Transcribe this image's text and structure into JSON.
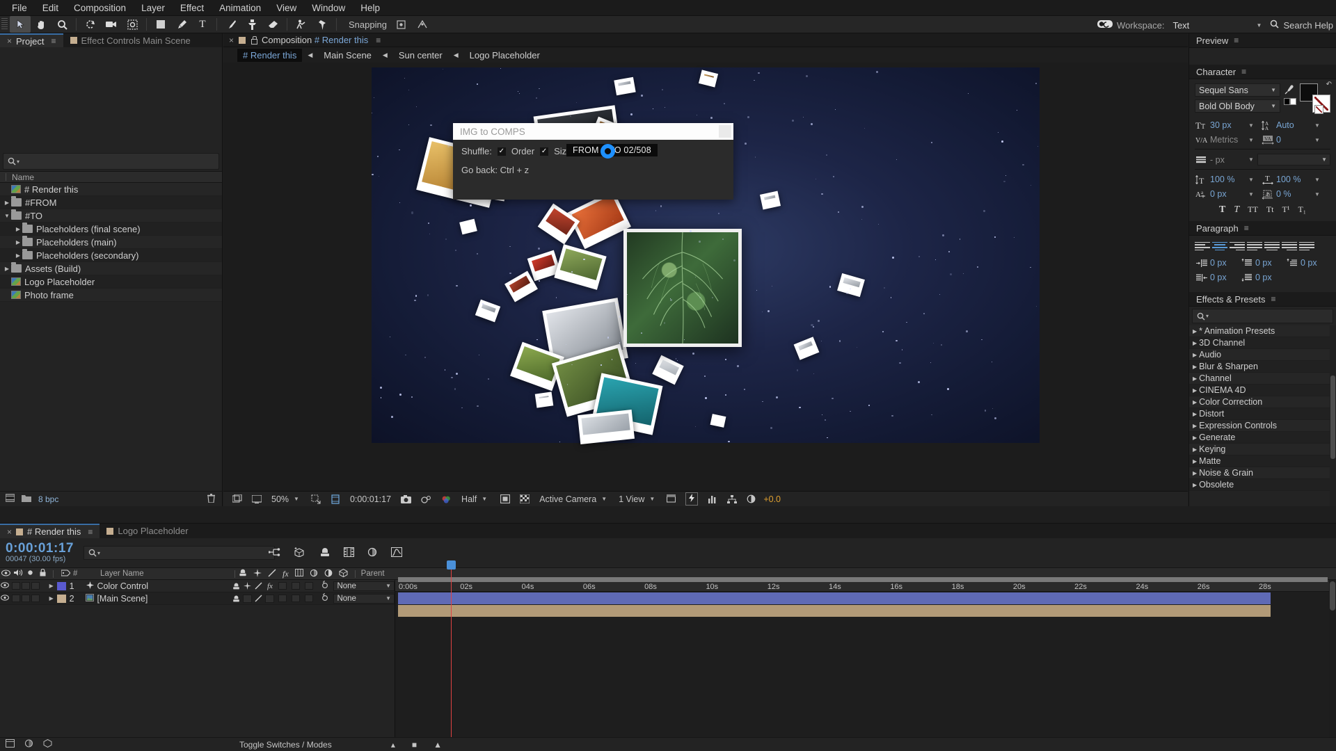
{
  "menu": [
    "File",
    "Edit",
    "Composition",
    "Layer",
    "Effect",
    "Animation",
    "View",
    "Window",
    "Help"
  ],
  "toolbar": {
    "snapping_label": "Snapping",
    "workspace_label": "Workspace:",
    "workspace_value": "Text",
    "search_help": "Search Help",
    "tools": [
      "select-tool",
      "hand-tool",
      "zoom-tool",
      "rotation-tool",
      "camera-tool",
      "pan-behind-tool",
      "shape-tool",
      "pen-tool",
      "type-tool",
      "brush-tool",
      "clone-stamp-tool",
      "eraser-tool",
      "roto-brush-tool",
      "puppet-pin-tool"
    ]
  },
  "project": {
    "tabs": [
      {
        "label": "Project",
        "active": true
      },
      {
        "label": "Effect Controls Main Scene",
        "active": false
      }
    ],
    "column_header": "Name",
    "items": [
      {
        "label": "# Render this",
        "type": "comp",
        "indent": 0,
        "tri": ""
      },
      {
        "label": "#FROM",
        "type": "folder",
        "indent": 0,
        "tri": "▶"
      },
      {
        "label": "#TO",
        "type": "folder",
        "indent": 0,
        "tri": "▼"
      },
      {
        "label": "Placeholders (final scene)",
        "type": "folder",
        "indent": 1,
        "tri": "▶"
      },
      {
        "label": "Placeholders (main)",
        "type": "folder",
        "indent": 1,
        "tri": "▶"
      },
      {
        "label": "Placeholders (secondary)",
        "type": "folder",
        "indent": 1,
        "tri": "▶"
      },
      {
        "label": "Assets (Build)",
        "type": "folder",
        "indent": 0,
        "tri": "▶"
      },
      {
        "label": "Logo Placeholder",
        "type": "comp",
        "indent": 0,
        "tri": ""
      },
      {
        "label": "Photo frame",
        "type": "comp",
        "indent": 0,
        "tri": ""
      }
    ],
    "bit_depth": "8 bpc"
  },
  "comp": {
    "tab_close": "×",
    "panel_label": "Composition",
    "comp_name": "# Render this",
    "breadcrumb": [
      {
        "label": "# Render this",
        "current": true
      },
      {
        "label": "Main Scene",
        "current": false
      },
      {
        "label": "Sun center",
        "current": false
      },
      {
        "label": "Logo Placeholder",
        "current": false
      }
    ],
    "footer": {
      "zoom": "50%",
      "time": "0:00:01:17",
      "resolution": "Half",
      "view_camera": "Active Camera",
      "views": "1 View",
      "exposure": "+0.0"
    }
  },
  "script_panel": {
    "title": "IMG to COMPS",
    "shuffle_label": "Shuffle:",
    "order_label": "Order",
    "size_label": "Size",
    "check_glyph": "✓",
    "progress_button": "FROM > TO  02/508",
    "progress_prefix": "FROM > TO",
    "progress_count": "02/508",
    "go_back": "Go back: Ctrl + z"
  },
  "right_dock": {
    "preview_title": "Preview",
    "character": {
      "title": "Character",
      "font_family": "Sequel Sans",
      "font_style": "Bold Obl Body",
      "font_size": "30 px",
      "leading": "Auto",
      "kerning": "Metrics",
      "tracking": "0",
      "stroke_width": "- px",
      "vertical_scale": "100 %",
      "horizontal_scale": "100 %",
      "baseline_shift": "0 px",
      "tsume": "0 %",
      "styles": [
        "T",
        "T",
        "TT",
        "Tt",
        "T¹",
        "T₁"
      ]
    },
    "paragraph": {
      "title": "Paragraph",
      "align_options": [
        "align-left",
        "align-center",
        "align-right",
        "justify-last-left",
        "justify-last-center",
        "justify-last-right",
        "justify-all"
      ],
      "active_align_index": 1,
      "indent_left": "0 px",
      "indent_right": "0 px",
      "indent_first": "0 px",
      "space_before": "0 px",
      "space_after": "0 px"
    },
    "effects_presets": {
      "title": "Effects & Presets",
      "items": [
        "* Animation Presets",
        "3D Channel",
        "Audio",
        "Blur & Sharpen",
        "Channel",
        "CINEMA 4D",
        "Color Correction",
        "Distort",
        "Expression Controls",
        "Generate",
        "Keying",
        "Matte",
        "Noise & Grain",
        "Obsolete"
      ]
    }
  },
  "timeline": {
    "tabs": [
      {
        "label": "# Render this",
        "active": true
      },
      {
        "label": "Logo Placeholder",
        "active": false
      }
    ],
    "current_time": "0:00:01:17",
    "frame_info": "00047 (30.00 fps)",
    "columns": [
      "#",
      "Layer Name",
      "Parent"
    ],
    "layers": [
      {
        "index": "1",
        "name": "Color Control",
        "color": "#5a5ad0",
        "type": "null",
        "parent": "None",
        "bar_color": "#5f6ab5",
        "bar_start": 0
      },
      {
        "index": "2",
        "name": "[Main Scene]",
        "color": "#c5ae90",
        "type": "comp",
        "parent": "None",
        "bar_color": "#b29a77",
        "bar_start": 0
      }
    ],
    "ruler_ticks": [
      "0:00s",
      "02s",
      "04s",
      "06s",
      "08s",
      "10s",
      "12s",
      "14s",
      "16s",
      "18s",
      "20s",
      "22s",
      "24s",
      "26s",
      "28s"
    ],
    "switches_label": "Toggle Switches / Modes"
  },
  "colors": {
    "accent_blue": "#7ba7d7",
    "cursor_blue": "#1e90ff",
    "timecode_blue": "#68a0d8",
    "comp_swatch": "#c5ae90"
  }
}
